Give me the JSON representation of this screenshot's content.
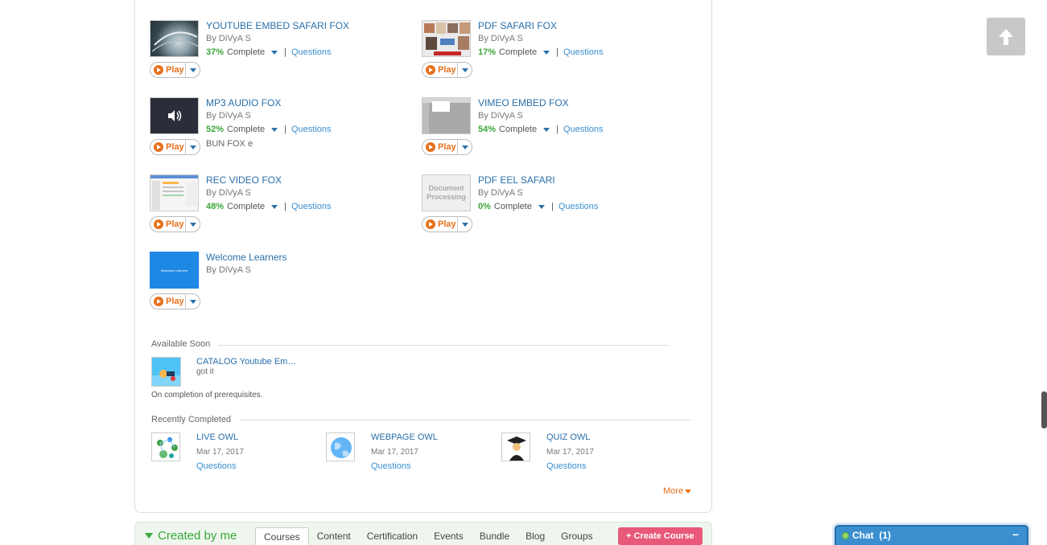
{
  "courses": [
    {
      "title": "YOUTUBE EMBED SAFARI FOX",
      "author": "By DiVyA S",
      "percent": "37%",
      "complete_label": "Complete",
      "sep": "|",
      "questions": "Questions",
      "play": "Play",
      "thumb": "earth"
    },
    {
      "title": "PDF SAFARI FOX",
      "author": "By DiVyA S",
      "percent": "17%",
      "complete_label": "Complete",
      "sep": "|",
      "questions": "Questions",
      "play": "Play",
      "thumb": "photos"
    },
    {
      "title": "MP3 AUDIO FOX",
      "author": "By DiVyA S",
      "percent": "52%",
      "complete_label": "Complete",
      "sep": "|",
      "questions": "Questions",
      "play": "Play",
      "extra": "BUN FOX e",
      "thumb": "audio"
    },
    {
      "title": "VIMEO EMBED FOX",
      "author": "By DiVyA S",
      "percent": "54%",
      "complete_label": "Complete",
      "sep": "|",
      "questions": "Questions",
      "play": "Play",
      "thumb": "screen"
    },
    {
      "title": "REC VIDEO FOX",
      "author": "By DiVyA S",
      "percent": "48%",
      "complete_label": "Complete",
      "sep": "|",
      "questions": "Questions",
      "play": "Play",
      "thumb": "ui"
    },
    {
      "title": "PDF EEL SAFARI",
      "author": "By DiVyA S",
      "percent": "0%",
      "complete_label": "Complete",
      "sep": "|",
      "questions": "Questions",
      "play": "Play",
      "thumb": "doc",
      "thumb_text": "Document Processing"
    },
    {
      "title": "Welcome Learners",
      "author": "By DiVyA S",
      "play": "Play",
      "thumb": "blue",
      "thumb_text": "Welcome Learners"
    }
  ],
  "available_soon": {
    "heading": "Available Soon",
    "item_title": "CATALOG Youtube Em…",
    "item_sub": "got it",
    "note": "On completion of prerequisites."
  },
  "recently_completed": {
    "heading": "Recently Completed",
    "items": [
      {
        "title": "LIVE OWL",
        "date": "Mar 17, 2017",
        "questions": "Questions",
        "icon": "network-icon"
      },
      {
        "title": "WEBPAGE OWL",
        "date": "Mar 17, 2017",
        "questions": "Questions",
        "icon": "globe-icon"
      },
      {
        "title": "QUIZ OWL",
        "date": "Mar 17, 2017",
        "questions": "Questions",
        "icon": "graduate-icon"
      }
    ],
    "more": "More"
  },
  "created_by_me": {
    "title": "Created by me",
    "tabs": [
      "Courses",
      "Content",
      "Certification",
      "Events",
      "Bundle",
      "Blog",
      "Groups"
    ],
    "active_tab": "Courses",
    "create_button": "+ Create Course"
  },
  "chat": {
    "label": "Chat",
    "count": "(1)",
    "minimize": "−"
  },
  "colors": {
    "accent_orange": "#e8701a",
    "link_blue": "#2a6fa8",
    "progress_green": "#3aa83a",
    "create_pink": "#e8587a",
    "chat_blue": "#3b8fcf"
  }
}
